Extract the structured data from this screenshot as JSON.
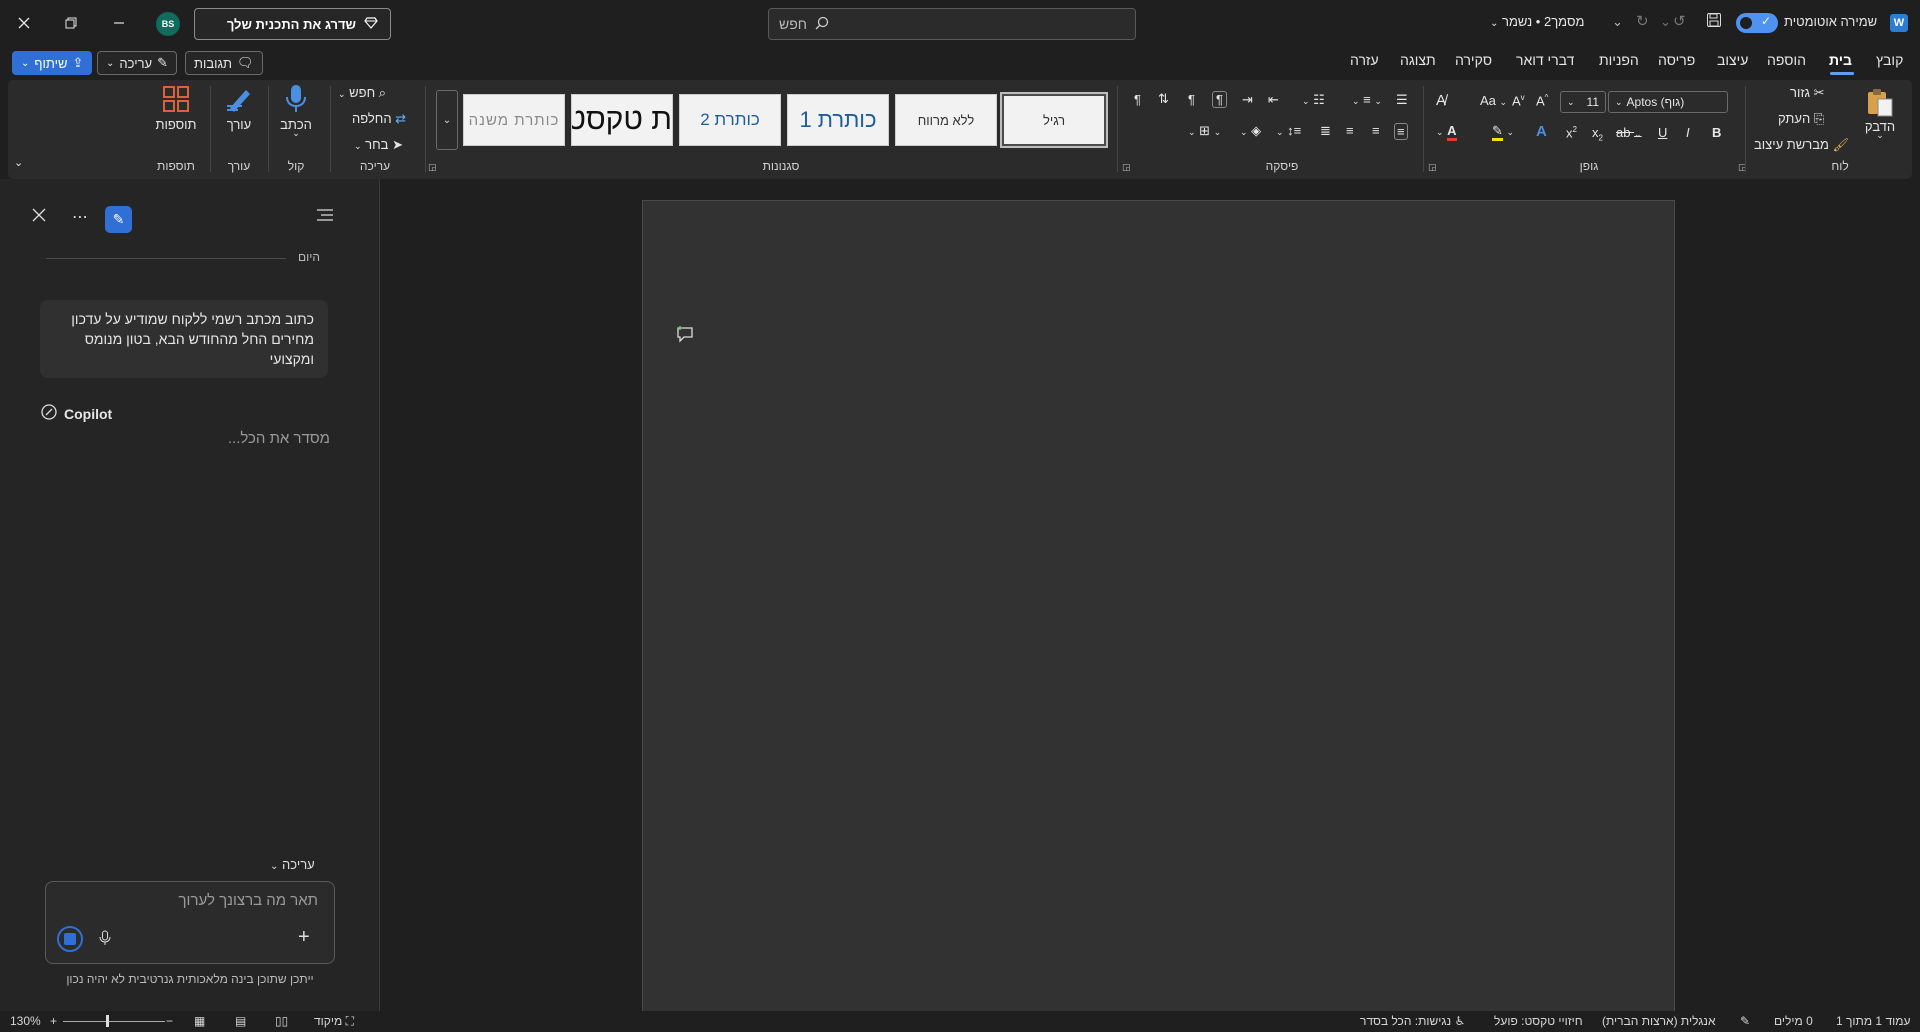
{
  "titlebar": {
    "upgrade_label": "שדרג את התכנית שלך",
    "avatar_initials": "BS",
    "search_placeholder": "חפש",
    "doc_title": "מסמך2 • נשמר",
    "autosave_label": "שמירה אוטומטית"
  },
  "tabs": [
    "קובץ",
    "בית",
    "הוספה",
    "עיצוב",
    "פריסה",
    "הפניות",
    "דברי דואר",
    "סקירה",
    "תצוגה",
    "עזרה"
  ],
  "actions": {
    "comments_label": "תגובות",
    "editing_label": "עריכה",
    "share_label": "שיתוף"
  },
  "ribbon": {
    "clipboard": {
      "paste": "הדבק",
      "cut": "גזור",
      "copy": "העתק",
      "format_painter": "מברשת עיצוב",
      "group": "לוח"
    },
    "font": {
      "name": "Aptos (גוף)",
      "size": "11",
      "group": "גופן"
    },
    "paragraph": {
      "group": "פיסקה"
    },
    "styles": {
      "items": [
        "רגיל",
        "ללא מרווח",
        "כותרת 1",
        "כותרת 2",
        "ת טקסט",
        "כותרת משנה"
      ],
      "group": "סגנונות"
    },
    "editing": {
      "find": "חפש",
      "replace": "החלפה",
      "select": "בחר",
      "group": "עריכה"
    },
    "voice": {
      "dictate": "הכתב",
      "group": "קול"
    },
    "editor": {
      "label": "עורך",
      "group": "עורך"
    },
    "addins": {
      "label": "תוספות",
      "group": "תוספות"
    }
  },
  "copilot": {
    "today": "היום",
    "prompt": "כתוב מכתב רשמי ללקוח שמודיע על עדכון מחירים החל מהחודש הבא, בטון מנומס ומקצועי",
    "name": "Copilot",
    "thinking": "מסדר את הכל...",
    "editing_toggle": "עריכה",
    "input_placeholder": "תאר מה ברצונך לערוך",
    "disclaimer": "ייתכן שתוכן בינה מלאכותית גנרטיבית לא יהיה נכון"
  },
  "statusbar": {
    "page": "עמוד 1 מתוך 1",
    "words": "0 מילים",
    "language": "אנגלית (ארצות הברית)",
    "predictions": "חיזויי טקסט: פועל",
    "accessibility": "נגישות: הכל בסדר",
    "focus": "מיקוד",
    "zoom": "130%"
  },
  "colors": {
    "accent": "#2f6fd6",
    "background": "#1f1f1f",
    "ribbon": "#2b2b2b",
    "page": "#323232"
  }
}
